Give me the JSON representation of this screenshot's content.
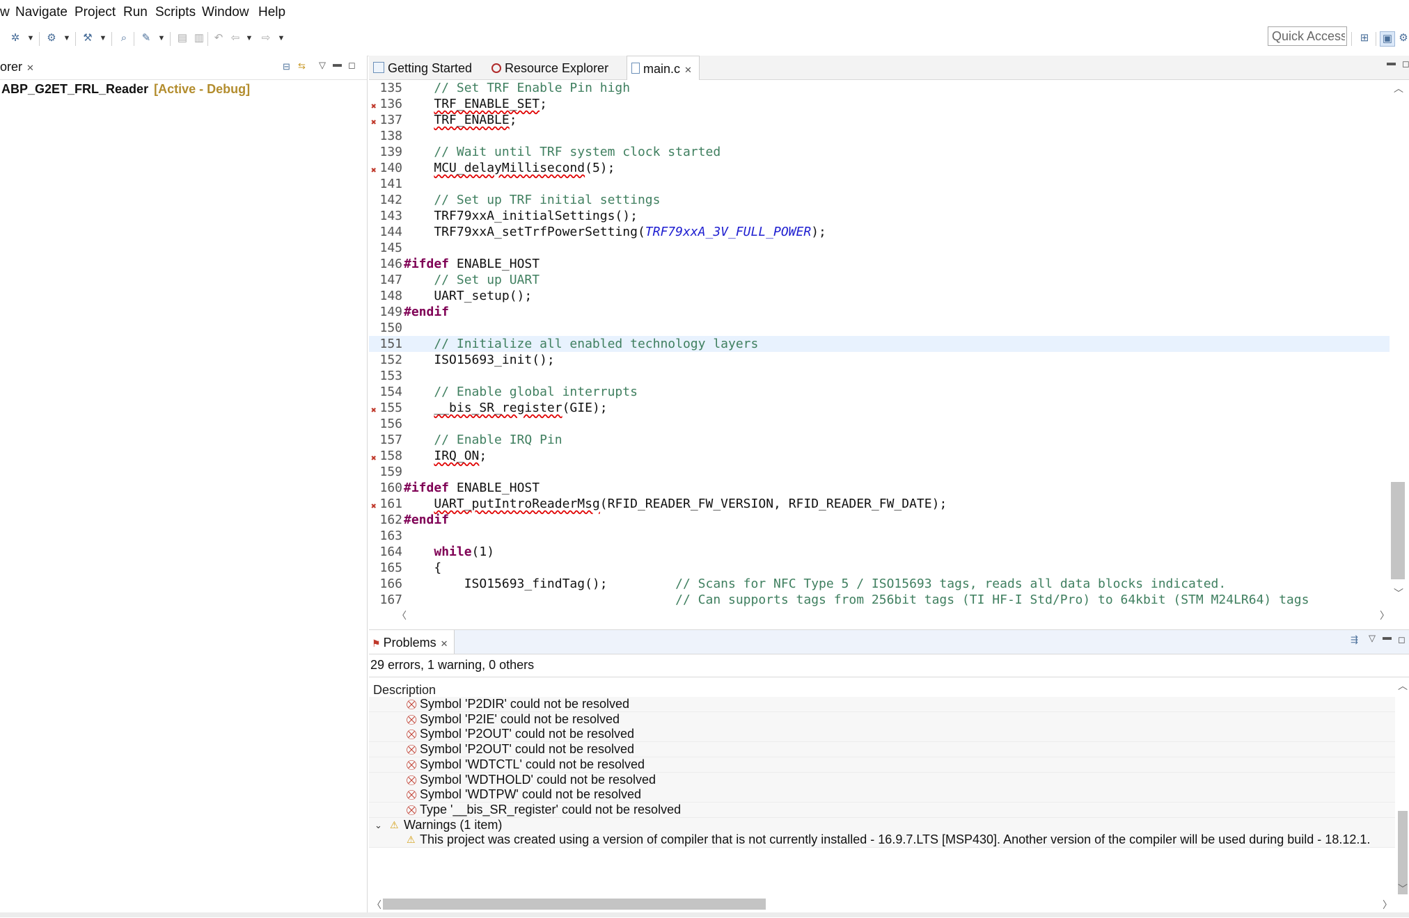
{
  "menu": [
    "w",
    "Navigate",
    "Project",
    "Run",
    "Scripts",
    "Window",
    "Help"
  ],
  "toolbar": {
    "quick_access": "Quick Access"
  },
  "explorer": {
    "tab_label": "orer",
    "project_name": "ABP_G2ET_FRL_Reader",
    "project_state": "[Active - Debug]"
  },
  "editor": {
    "tabs": [
      {
        "label": "Getting Started",
        "icon": "page-icon"
      },
      {
        "label": "Resource Explorer",
        "icon": "compass-icon"
      },
      {
        "label": "main.c",
        "icon": "c-file-icon"
      }
    ],
    "lines": [
      {
        "num": "135",
        "text": "    // Set TRF Enable Pin high",
        "kind": "comment"
      },
      {
        "num": "136",
        "text": "    TRF_ENABLE_SET;",
        "kind": "err",
        "bp": true
      },
      {
        "num": "137",
        "text": "    TRF_ENABLE;",
        "kind": "err",
        "bp": true
      },
      {
        "num": "138",
        "text": "",
        "kind": "plain"
      },
      {
        "num": "139",
        "text": "    // Wait until TRF system clock started",
        "kind": "comment"
      },
      {
        "num": "140",
        "text": "    MCU_delayMillisecond(5);",
        "kind": "err",
        "bp": true
      },
      {
        "num": "141",
        "text": "",
        "kind": "plain"
      },
      {
        "num": "142",
        "text": "    // Set up TRF initial settings",
        "kind": "comment"
      },
      {
        "num": "143",
        "text": "    TRF79xxA_initialSettings();",
        "kind": "plain"
      },
      {
        "num": "144",
        "text": "    TRF79xxA_setTrfPowerSetting(TRF79xxA_3V_FULL_POWER);",
        "kind": "macro"
      },
      {
        "num": "145",
        "text": "",
        "kind": "plain"
      },
      {
        "num": "146",
        "text": "#ifdef ENABLE_HOST",
        "kind": "directive"
      },
      {
        "num": "147",
        "text": "    // Set up UART",
        "kind": "comment"
      },
      {
        "num": "148",
        "text": "    UART_setup();",
        "kind": "plain"
      },
      {
        "num": "149",
        "text": "#endif",
        "kind": "kw"
      },
      {
        "num": "150",
        "text": "",
        "kind": "plain"
      },
      {
        "num": "151",
        "text": "    // Initialize all enabled technology layers",
        "kind": "comment",
        "hl": true
      },
      {
        "num": "152",
        "text": "    ISO15693_init();",
        "kind": "plain"
      },
      {
        "num": "153",
        "text": "",
        "kind": "plain"
      },
      {
        "num": "154",
        "text": "    // Enable global interrupts",
        "kind": "comment"
      },
      {
        "num": "155",
        "text": "    __bis_SR_register(GIE);",
        "kind": "err",
        "bp": true
      },
      {
        "num": "156",
        "text": "",
        "kind": "plain"
      },
      {
        "num": "157",
        "text": "    // Enable IRQ Pin",
        "kind": "comment"
      },
      {
        "num": "158",
        "text": "    IRQ_ON;",
        "kind": "err",
        "bp": true
      },
      {
        "num": "159",
        "text": "",
        "kind": "plain"
      },
      {
        "num": "160",
        "text": "#ifdef ENABLE_HOST",
        "kind": "directive"
      },
      {
        "num": "161",
        "text": "    UART_putIntroReaderMsg(RFID_READER_FW_VERSION, RFID_READER_FW_DATE);",
        "kind": "errcall",
        "bp": true
      },
      {
        "num": "162",
        "text": "#endif",
        "kind": "kw"
      },
      {
        "num": "163",
        "text": "",
        "kind": "plain"
      },
      {
        "num": "164",
        "text": "    while(1)",
        "kind": "while"
      },
      {
        "num": "165",
        "text": "    {",
        "kind": "plain"
      },
      {
        "num": "166",
        "text": "        ISO15693_findTag();         // Scans for NFC Type 5 / ISO15693 tags, reads all data blocks indicated.",
        "kind": "codecomment"
      },
      {
        "num": "167",
        "text": "                                    // Can supports tags from 256bit tags (TI HF-I Std/Pro) to 64kbit (STM M24LR64) tags",
        "kind": "comment"
      }
    ]
  },
  "problems": {
    "tab_label": "Problems",
    "summary": "29 errors, 1 warning, 0 others",
    "column": "Description",
    "rows": [
      {
        "text": "Symbol 'P2DIR' could not be resolved",
        "type": "error"
      },
      {
        "text": "Symbol 'P2IE' could not be resolved",
        "type": "error"
      },
      {
        "text": "Symbol 'P2OUT' could not be resolved",
        "type": "error"
      },
      {
        "text": "Symbol 'P2OUT' could not be resolved",
        "type": "error"
      },
      {
        "text": "Symbol 'WDTCTL' could not be resolved",
        "type": "error"
      },
      {
        "text": "Symbol 'WDTHOLD' could not be resolved",
        "type": "error"
      },
      {
        "text": "Symbol 'WDTPW' could not be resolved",
        "type": "error"
      },
      {
        "text": "Type '__bis_SR_register' could not be resolved",
        "type": "error"
      },
      {
        "text": "Warnings (1 item)",
        "type": "group"
      },
      {
        "text": "This project was created using a version of compiler that is not currently installed - 16.9.7.LTS [MSP430]. Another version of the compiler will be used during build - 18.12.1.",
        "type": "warning"
      }
    ]
  },
  "colors": {
    "comment": "#3f7f5f",
    "keyword": "#7f0055",
    "macro": "#1e1ed0",
    "project_state": "#b38d2e",
    "error_marker": "#c0392b",
    "warning_marker": "#d4a017"
  }
}
